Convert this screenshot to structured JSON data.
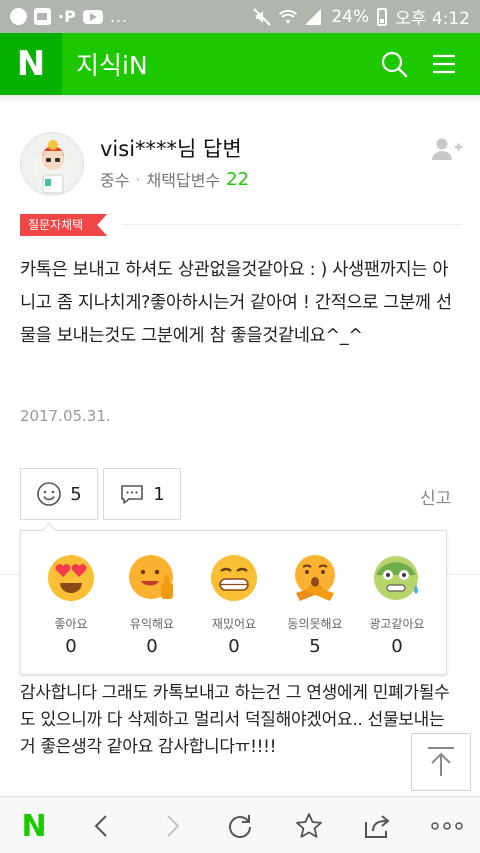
{
  "status_bar": {
    "battery": "24%",
    "time": "오후 4:12",
    "overflow": "..."
  },
  "header": {
    "logo_letter": "N",
    "title": "지식iN",
    "icons": [
      "search-icon",
      "menu-icon"
    ]
  },
  "answer": {
    "author": "visi****님 답변",
    "rank": "중수",
    "adopted_label": "채택답변수",
    "adopted_count": "22",
    "badge": "질문자채택",
    "body": "카톡은 보내고 하셔도 상관없을것같아요 : ) 사생팬까지는 아니고 좀 지나치게?좋아하시는거 같아여 ! 간적으로 그분께 선물을 보내는것도 그분에게 참 좋을것같네요^_^",
    "date": "2017.05.31."
  },
  "reactions": {
    "smile_count": "5",
    "comment_count": "1",
    "report_label": "신고"
  },
  "emotions": [
    {
      "label": "좋아요",
      "count": "0",
      "icon": "heart-eyes-icon"
    },
    {
      "label": "유익해요",
      "count": "0",
      "icon": "thumbs-up-face-icon"
    },
    {
      "label": "재밌어요",
      "count": "0",
      "icon": "grin-face-icon"
    },
    {
      "label": "동의못해요",
      "count": "5",
      "icon": "crossed-arms-face-icon"
    },
    {
      "label": "광고같아요",
      "count": "0",
      "icon": "sick-face-icon"
    }
  ],
  "comment": {
    "body": "감사합니다 그래도 카톡보내고 하는건 그 연생에게 민폐가될수도 있으니까 다 삭제하고 멀리서 덕질해야겠어요.. 선물보내는 거 좋은생각 같아요 감사합니다ㅠ!!!!"
  },
  "toolbar": {
    "logo_letter": "N",
    "icons": [
      "back-icon",
      "forward-icon",
      "refresh-icon",
      "bookmark-star-icon",
      "share-icon",
      "more-icon"
    ]
  },
  "colors": {
    "brand_green": "#1ec800",
    "badge_red": "#f04646"
  }
}
